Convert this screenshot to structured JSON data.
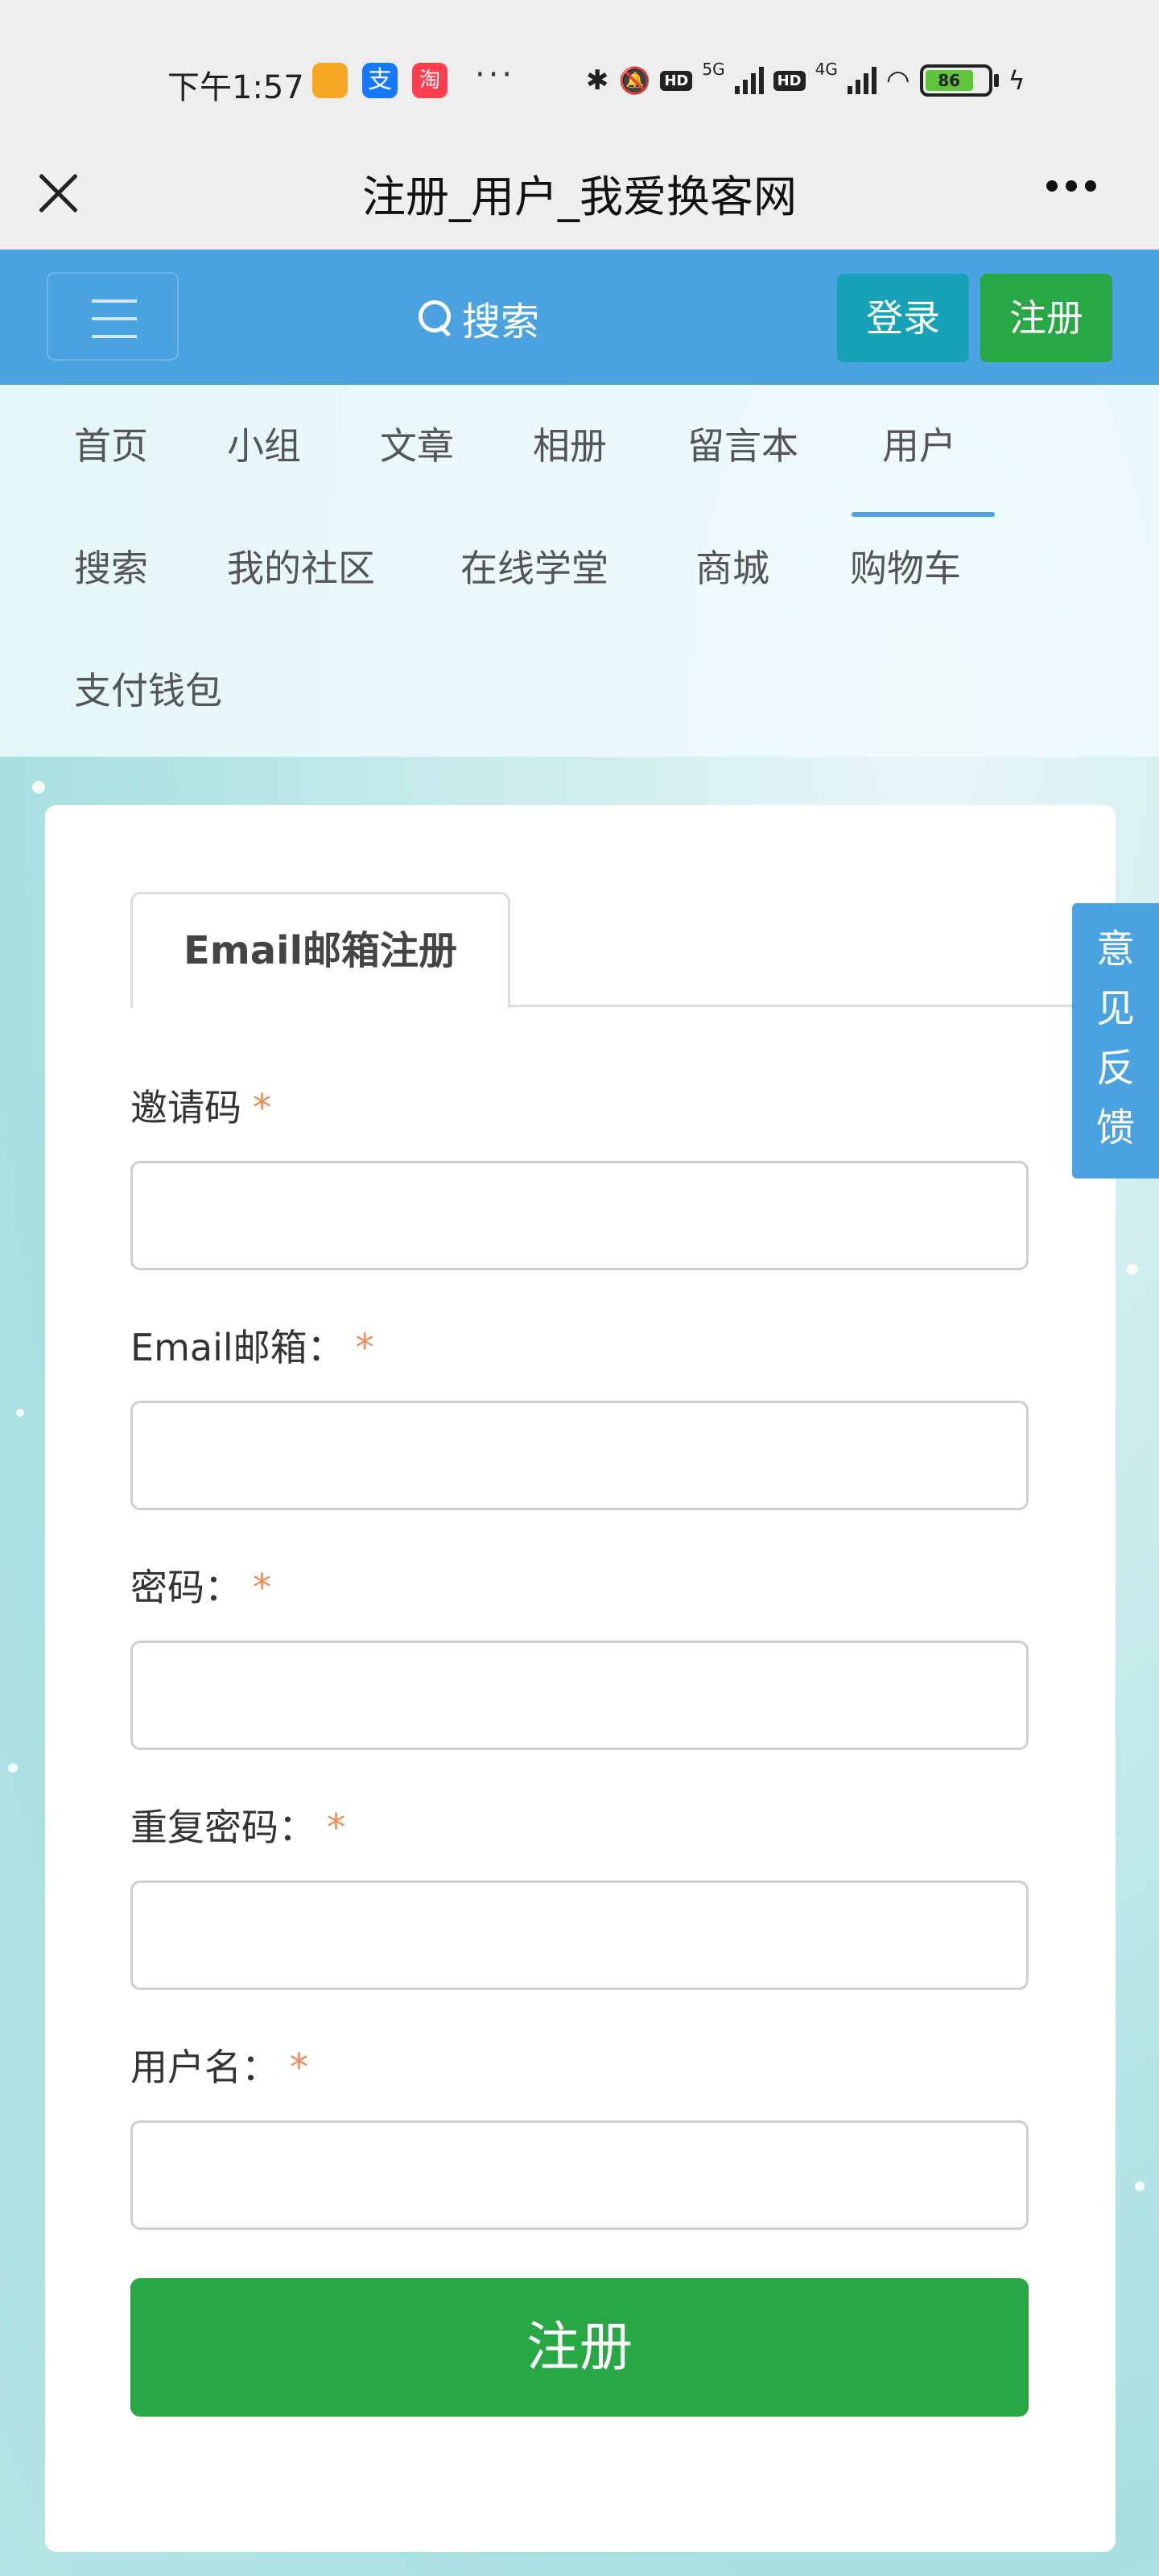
{
  "statusbar": {
    "time": "下午1:57",
    "app_icons": [
      "gallery-icon",
      "alipay-icon",
      "taobao-icon"
    ],
    "alipay_glyph": "支",
    "taobao_glyph": "淘",
    "more": "···",
    "hd1": "HD",
    "net1": "5G",
    "hd2": "HD",
    "net2": "4G",
    "battery": "86"
  },
  "titlebar": {
    "title": "注册_用户_我爱换客网"
  },
  "topnav": {
    "search_label": "搜索",
    "login_label": "登录",
    "register_label": "注册",
    "accent_color": "#4aa3e0"
  },
  "nav": {
    "items": [
      {
        "label": "首页"
      },
      {
        "label": "小组"
      },
      {
        "label": "文章"
      },
      {
        "label": "相册"
      },
      {
        "label": "留言本"
      },
      {
        "label": "用户",
        "active": true
      },
      {
        "label": "搜索"
      },
      {
        "label": "我的社区"
      },
      {
        "label": "在线学堂"
      },
      {
        "label": "商城"
      },
      {
        "label": "购物车"
      },
      {
        "label": "支付钱包"
      }
    ]
  },
  "form": {
    "tab_label": "Email邮箱注册",
    "required_mark": "*",
    "fields": [
      {
        "label": "邀请码",
        "value": "",
        "placeholder": ""
      },
      {
        "label": "Email邮箱：",
        "value": "",
        "placeholder": ""
      },
      {
        "label": "密码：",
        "value": "",
        "placeholder": ""
      },
      {
        "label": "重复密码：",
        "value": "",
        "placeholder": ""
      },
      {
        "label": "用户名：",
        "value": "",
        "placeholder": ""
      }
    ],
    "submit_label": "注册",
    "submit_color": "#28a745"
  },
  "feedback": {
    "chars": [
      "意",
      "见",
      "反",
      "馈"
    ]
  }
}
